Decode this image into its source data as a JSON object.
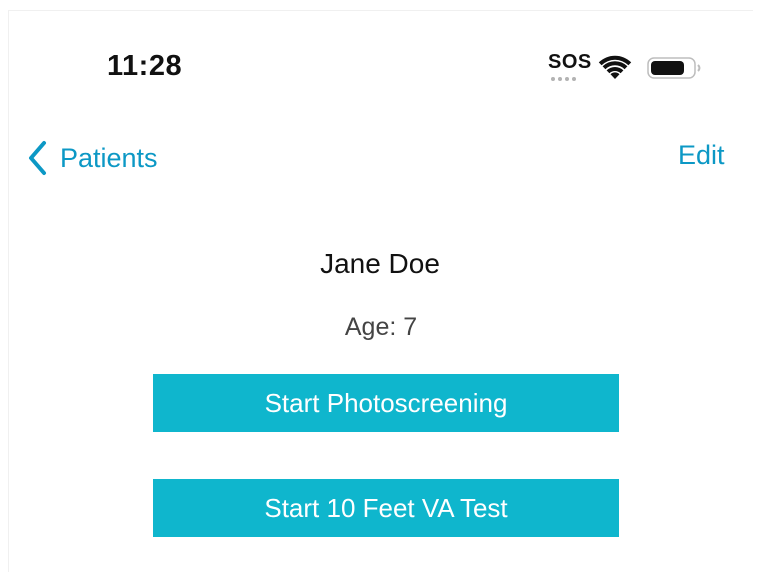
{
  "status_bar": {
    "time": "11:28",
    "sos": "SOS",
    "wifi_icon": "wifi-icon",
    "battery_icon": "battery-icon"
  },
  "nav": {
    "back_label": "Patients",
    "back_icon": "chevron-left-icon",
    "edit_label": "Edit",
    "accent_color": "#0c98c5"
  },
  "patient": {
    "name": "Jane Doe",
    "age_text": "Age: 7"
  },
  "actions": {
    "photoscreening_label": "Start Photoscreening",
    "va_test_label": "Start 10 Feet VA Test",
    "button_color": "#0fb6cd"
  }
}
